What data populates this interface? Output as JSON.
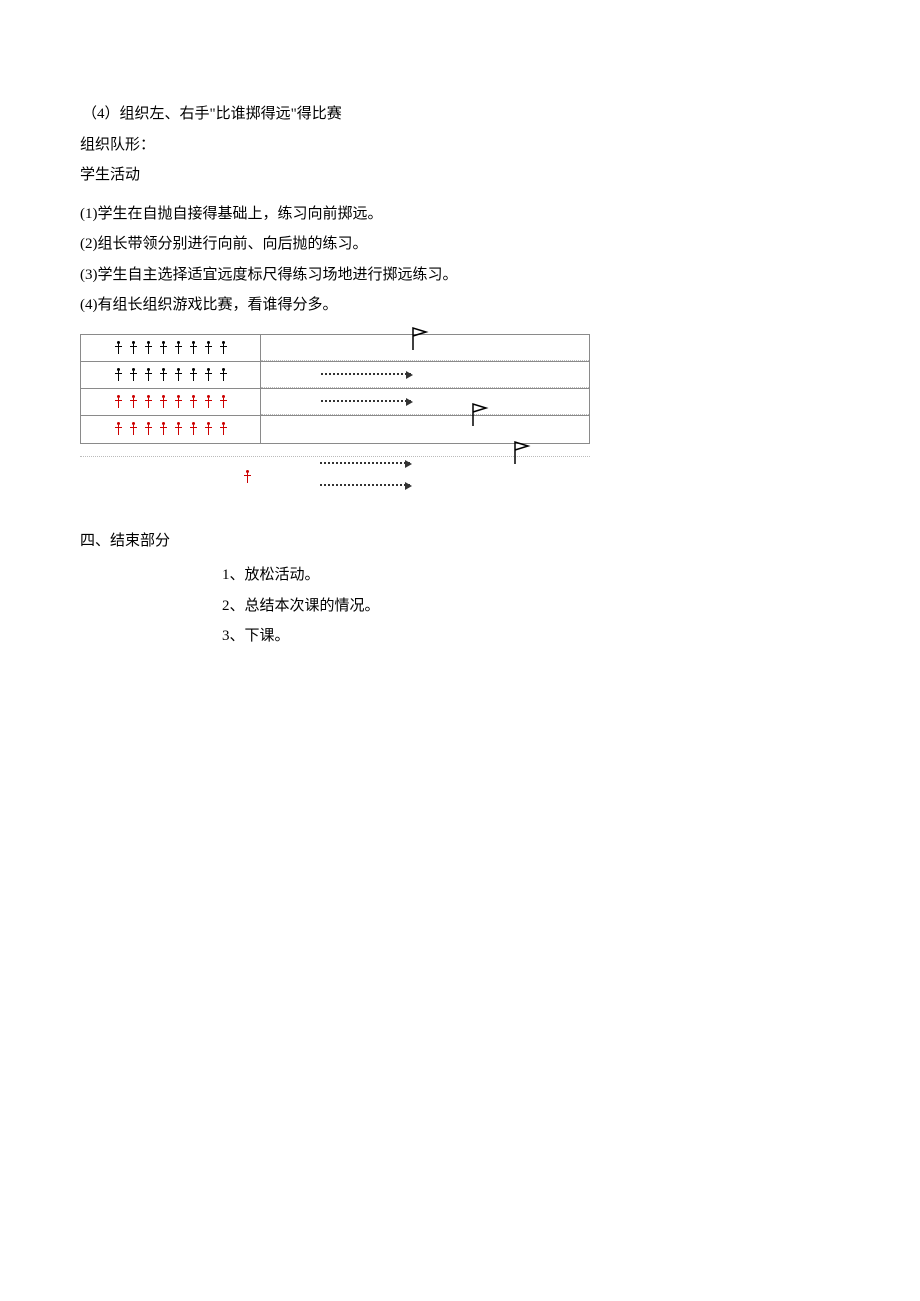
{
  "lines": {
    "l1": "（4）组织左、右手\"比谁掷得远\"得比赛",
    "l2": "组织队形：",
    "l3": "学生活动",
    "l4": "(1)学生在自抛自接得基础上，练习向前掷远。",
    "l5": "(2)组长带领分别进行向前、向后抛的练习。",
    "l6": "(3)学生自主选择适宜远度标尺得练习场地进行掷远练习。",
    "l7": "(4)有组长组织游戏比赛，看谁得分多。"
  },
  "section4": {
    "heading": "四、结束部分",
    "items": {
      "i1": "1、放松活动。",
      "i2": "2、总结本次课的情况。",
      "i3": "3、下课。"
    }
  },
  "diagram": {
    "rows_black": 2,
    "rows_red": 2,
    "figs_per_row": 8,
    "arrows_in_box": 2,
    "arrows_below": 2,
    "flags": 3,
    "standalone_fig_color": "red"
  }
}
